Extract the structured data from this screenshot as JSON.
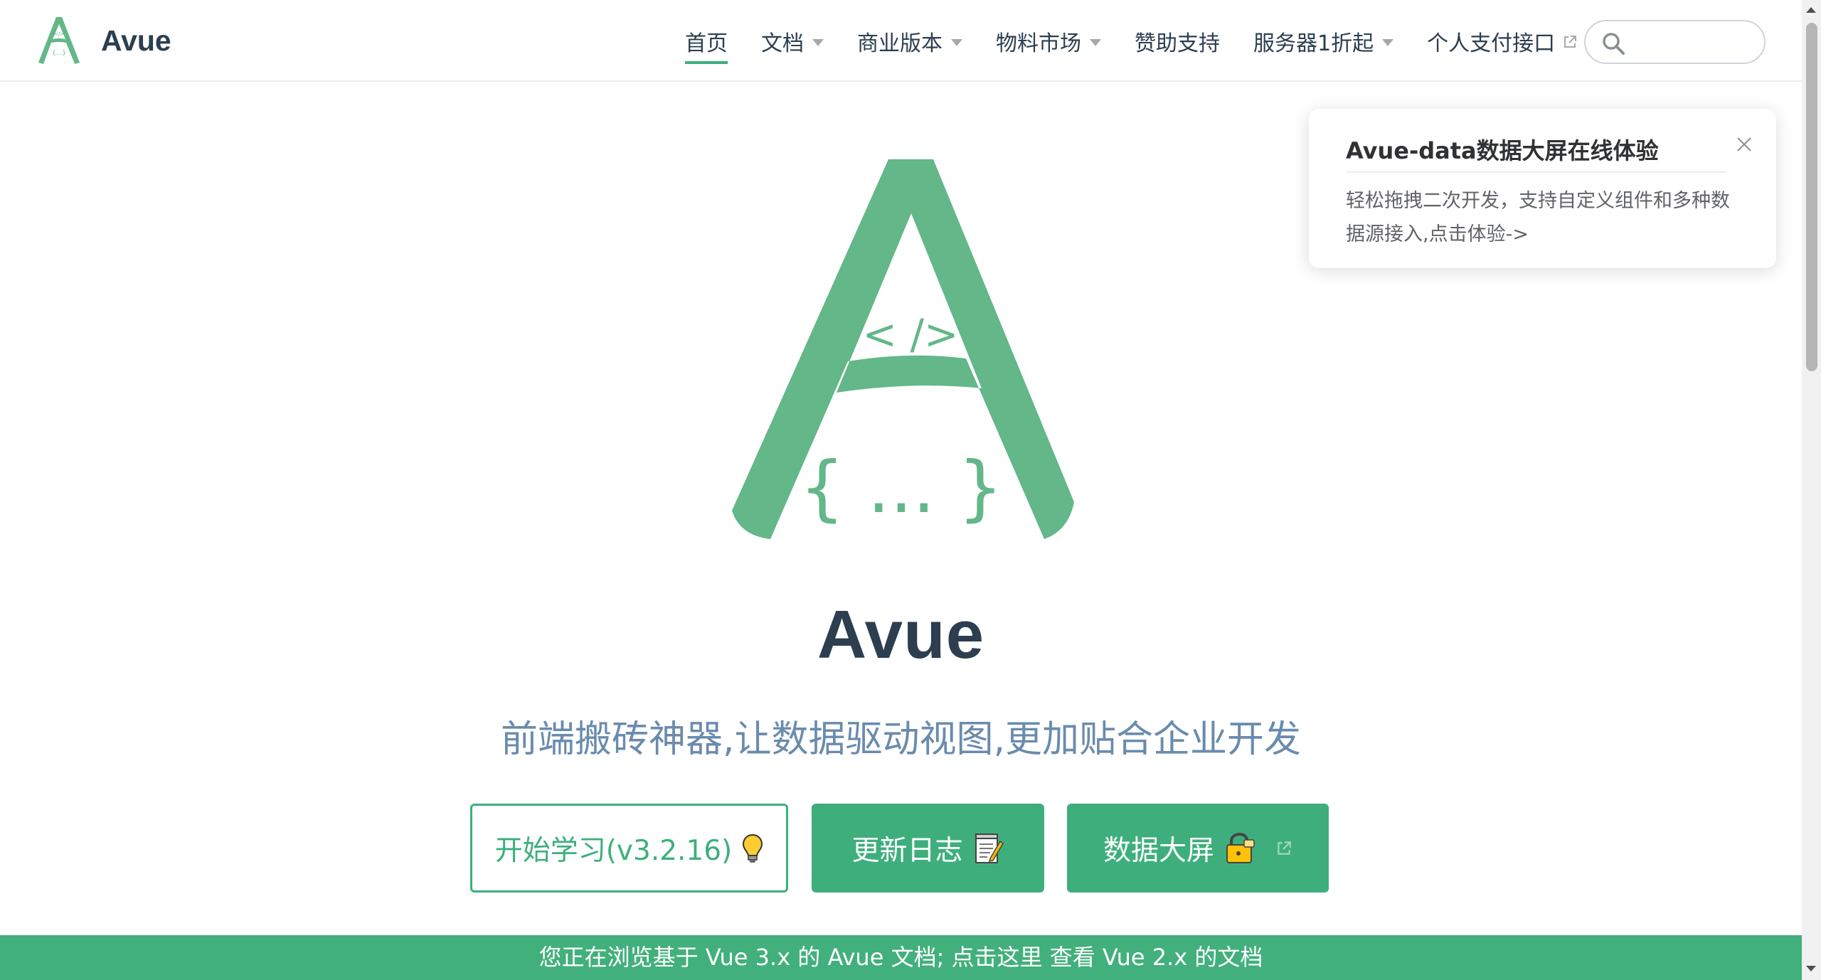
{
  "brand": {
    "name": "Avue",
    "logo_icon": "avue-logo-icon"
  },
  "nav": {
    "items": [
      {
        "label": "首页",
        "active": true,
        "dropdown": false,
        "external": false
      },
      {
        "label": "文档",
        "active": false,
        "dropdown": true,
        "external": false
      },
      {
        "label": "商业版本",
        "active": false,
        "dropdown": true,
        "external": false
      },
      {
        "label": "物料市场",
        "active": false,
        "dropdown": true,
        "external": false
      },
      {
        "label": "赞助支持",
        "active": false,
        "dropdown": false,
        "external": false
      },
      {
        "label": "服务器1折起",
        "active": false,
        "dropdown": true,
        "external": false
      },
      {
        "label": "个人支付接口",
        "active": false,
        "dropdown": false,
        "external": true
      }
    ],
    "search": {
      "placeholder": "",
      "value": ""
    }
  },
  "hero": {
    "logo_code_text": "< />",
    "logo_braces_text": "{ ... }",
    "title": "Avue",
    "description": "前端搬砖神器,让数据驱动视图,更加贴合企业开发",
    "buttons": {
      "learn": {
        "label": "开始学习(v3.2.16)",
        "icon": "light-bulb-icon"
      },
      "changelog": {
        "label": "更新日志",
        "icon": "memo-icon"
      },
      "data_screen": {
        "label": "数据大屏",
        "icon": "lock-icon",
        "external": true
      }
    }
  },
  "notification": {
    "title": "Avue-data数据大屏在线体验",
    "message": "轻松拖拽二次开发，支持自定义组件和多种数据源接入,点击体验->"
  },
  "banner": {
    "text": "您正在浏览基于 Vue 3.x 的 Avue 文档; 点击这里 查看 Vue 2.x 的文档"
  },
  "colors": {
    "accent": "#3eaf7c",
    "logo_green": "#63b788",
    "text": "#2c3e50",
    "description": "#6a8bad",
    "banner": "#42b07c"
  }
}
